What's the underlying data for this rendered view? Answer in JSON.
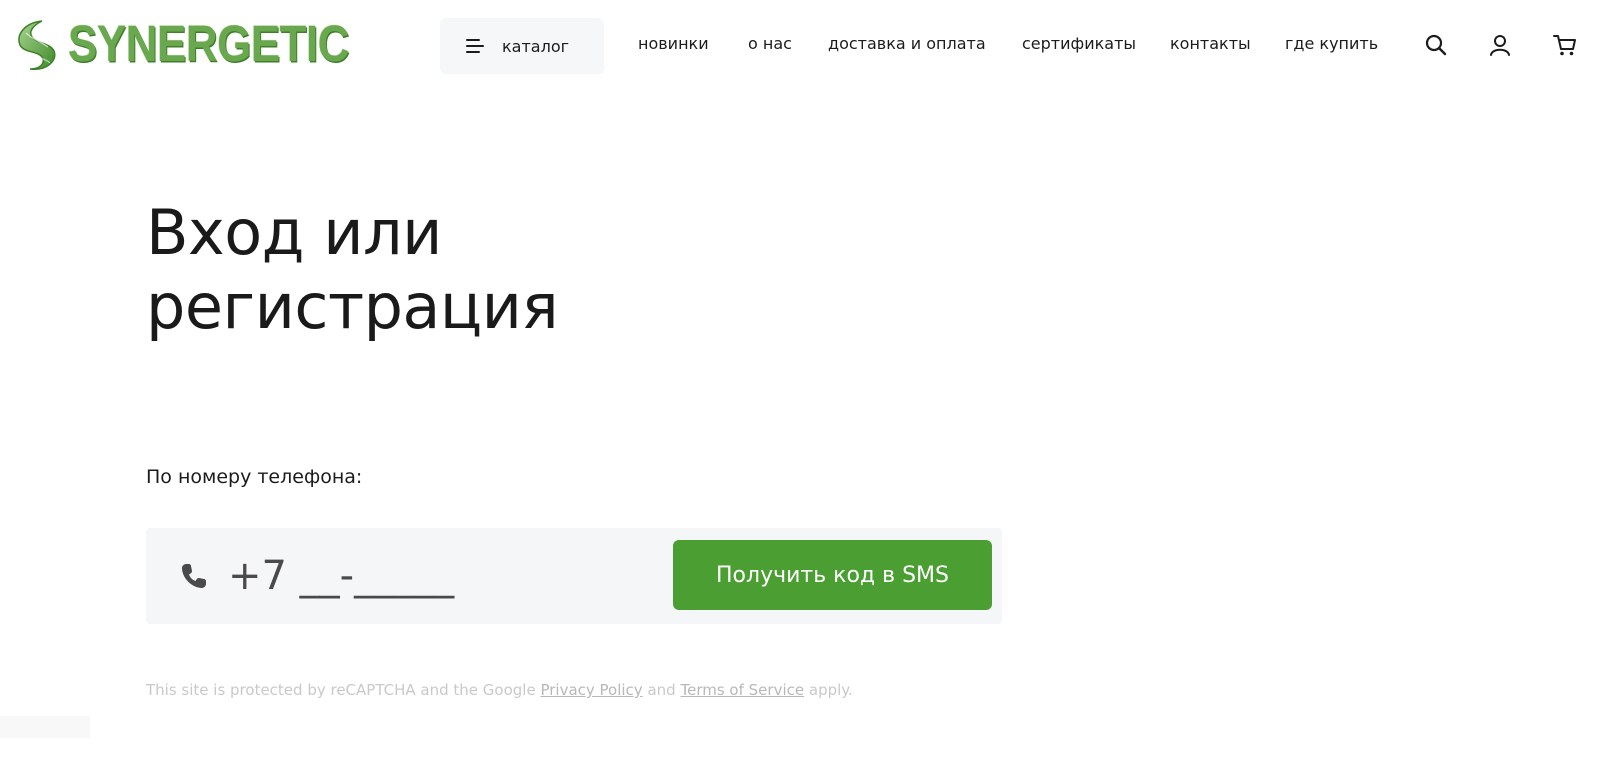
{
  "header": {
    "logo_text": "SYNERGETIC",
    "catalog_label": "каталог",
    "nav": [
      {
        "label": "новинки"
      },
      {
        "label": "о нас"
      },
      {
        "label": "доставка и оплата"
      },
      {
        "label": "сертификаты"
      },
      {
        "label": "контакты"
      },
      {
        "label": "где купить"
      }
    ],
    "icons": [
      "search-icon",
      "user-icon",
      "cart-icon"
    ]
  },
  "main": {
    "title_line1": "Вход или",
    "title_line2": "регистрация",
    "phone_label": "По номеру телефона:",
    "phone_placeholder": "+7 __-_____",
    "sms_button": "Получить код в SMS",
    "recaptcha": {
      "prefix": "This site is protected by reCAPTCHA and the Google",
      "privacy": "Privacy Policy",
      "and": "and",
      "terms": "Terms of Service",
      "suffix": "apply."
    }
  },
  "colors": {
    "accent": "#4a9e32",
    "logo": "#6aa84f",
    "input_bg": "#f5f6f7",
    "catalog_bg": "#f6f7f8"
  }
}
